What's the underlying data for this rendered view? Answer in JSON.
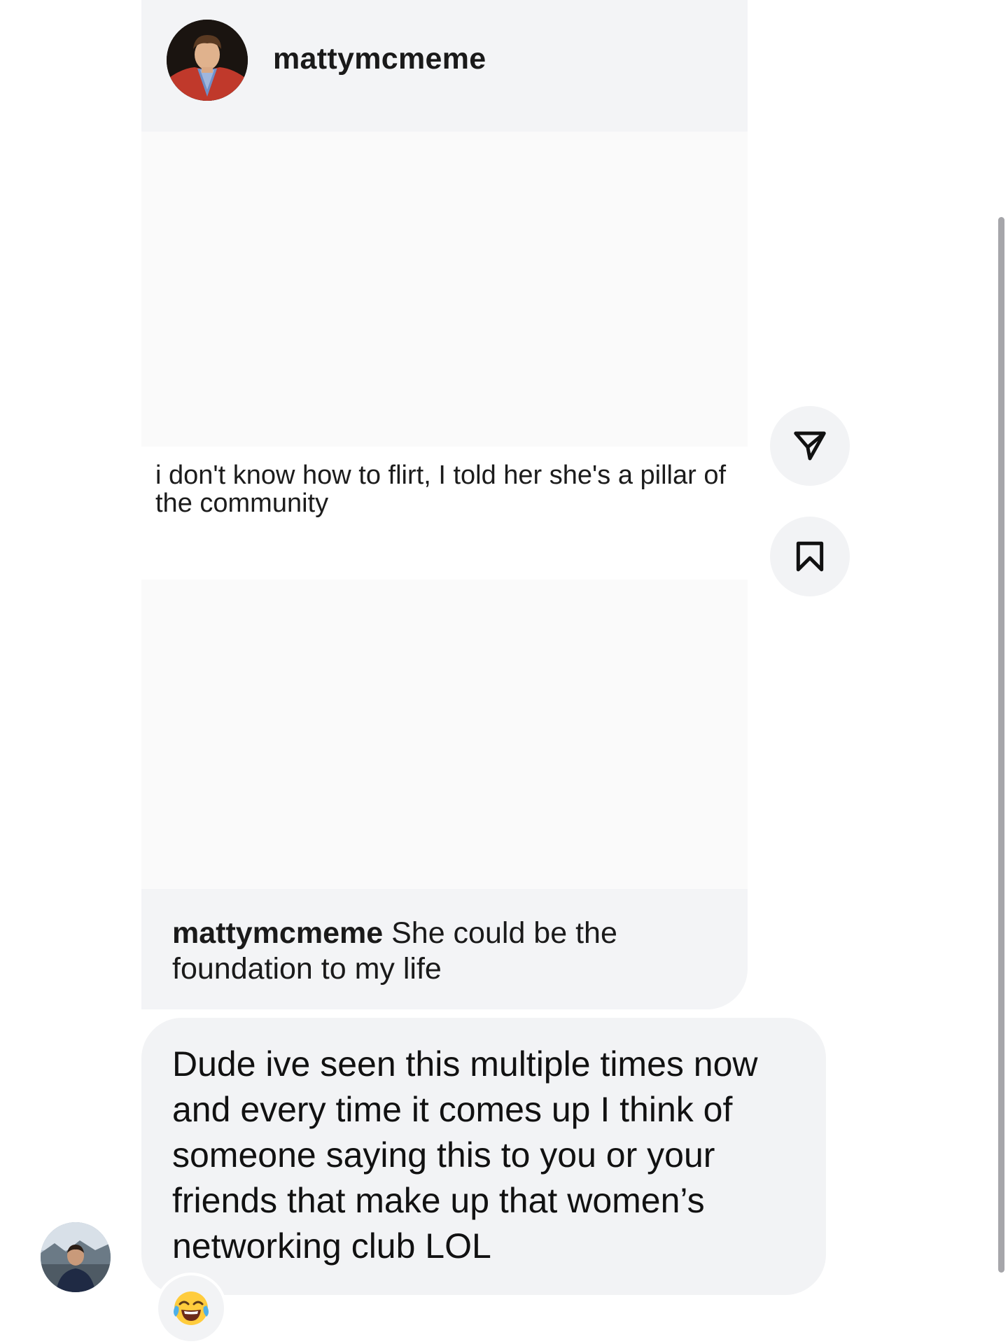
{
  "post": {
    "header_username": "mattymcmeme",
    "avatar_icon": "profile-photo-icon",
    "meme_text": "i don't know how to flirt, I told her she's a pillar of the community",
    "caption_username": "mattymcmeme",
    "caption_text": " She could be the foundation to my life"
  },
  "actions": {
    "share_icon": "paper-plane-icon",
    "save_icon": "bookmark-icon"
  },
  "message": {
    "text": "Dude ive seen this multiple times now and every time it comes up I think of someone saying this to you or your friends that make up that women’s networking club LOL",
    "sender_avatar_icon": "sender-avatar-icon",
    "reaction_icon": "face-with-tears-of-joy-icon"
  },
  "colors": {
    "card_bg": "#f3f4f6",
    "meme_bg": "#fafafa",
    "text": "#111111"
  }
}
